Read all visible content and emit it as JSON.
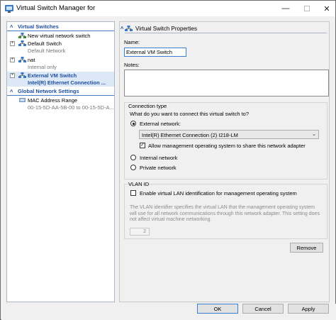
{
  "window": {
    "title": "Virtual Switch Manager for"
  },
  "tree": {
    "section_virtual_switches": "Virtual Switches",
    "new_switch": "New virtual network switch",
    "default_switch": {
      "name": "Default Switch",
      "subtitle": "Default Network"
    },
    "nat": {
      "name": "nat",
      "subtitle": "Internal only"
    },
    "external_switch": {
      "name": "External VM Switch",
      "subtitle": "Intel(R) Ethernet Connection ..."
    },
    "section_global": "Global Network Settings",
    "mac_range": {
      "name": "MAC Address Range",
      "subtitle": "00-15-5D-AA-5B-00 to 00-15-5D-A..."
    }
  },
  "properties": {
    "header": "Virtual Switch Properties",
    "name_label": "Name:",
    "name_value": "External VM Switch",
    "notes_label": "Notes:",
    "connection_type": {
      "legend": "Connection type",
      "question": "What do you want to connect this virtual switch to?",
      "external_label": "External network:",
      "external_selected": true,
      "adapter_value": "Intel(R) Ethernet Connection (2) I218-LM",
      "allow_mgmt_label": "Allow management operating system to share this network adapter",
      "allow_mgmt_checked": true,
      "internal_label": "Internal network",
      "private_label": "Private network"
    },
    "vlan": {
      "legend": "VLAN ID",
      "enable_label": "Enable virtual LAN identification for management operating system",
      "enable_checked": false,
      "description": "The VLAN identifier specifies the virtual LAN that the management operating system will use for all network communications through this network adapter. This setting does not affect virtual machine networking.",
      "value": "2"
    },
    "remove_label": "Remove"
  },
  "footer": {
    "ok_label": "OK",
    "cancel_label": "Cancel",
    "apply_label": "Apply"
  },
  "colors": {
    "accent": "#1e4fa0",
    "selection": "#dde8f6",
    "focus_border": "#3c7fd0"
  }
}
